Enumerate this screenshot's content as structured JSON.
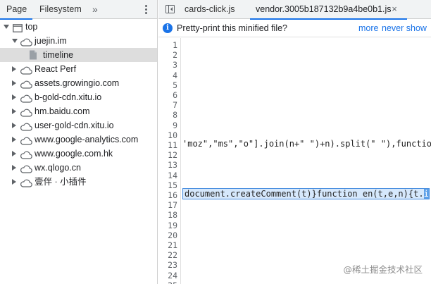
{
  "navigator": {
    "tabs": [
      "Page",
      "Filesystem"
    ],
    "more_glyph": "»",
    "menu_icon": "kebab-menu-icon",
    "tree": [
      {
        "label": "top",
        "icon": "frame-icon",
        "arrow": "down",
        "level": 0
      },
      {
        "label": "juejin.im",
        "icon": "cloud-icon",
        "arrow": "down",
        "level": 1
      },
      {
        "label": "timeline",
        "icon": "file-icon",
        "arrow": "",
        "level": 2,
        "selected": true
      },
      {
        "label": "React Perf",
        "icon": "cloud-icon",
        "arrow": "right",
        "level": 1
      },
      {
        "label": "assets.growingio.com",
        "icon": "cloud-icon",
        "arrow": "right",
        "level": 1
      },
      {
        "label": "b-gold-cdn.xitu.io",
        "icon": "cloud-icon",
        "arrow": "right",
        "level": 1
      },
      {
        "label": "hm.baidu.com",
        "icon": "cloud-icon",
        "arrow": "right",
        "level": 1
      },
      {
        "label": "user-gold-cdn.xitu.io",
        "icon": "cloud-icon",
        "arrow": "right",
        "level": 1
      },
      {
        "label": "www.google-analytics.com",
        "icon": "cloud-icon",
        "arrow": "right",
        "level": 1
      },
      {
        "label": "www.google.com.hk",
        "icon": "cloud-icon",
        "arrow": "right",
        "level": 1
      },
      {
        "label": "wx.qlogo.cn",
        "icon": "cloud-icon",
        "arrow": "right",
        "level": 1
      },
      {
        "label": "壹伴 · 小插件",
        "icon": "cloud-icon",
        "arrow": "right",
        "level": 1
      }
    ]
  },
  "editor": {
    "tabs": [
      "cards-click.js",
      "vendor.3005b187132b9a4be0b1.js"
    ],
    "active_tab": 1,
    "close_glyph": "×",
    "infobar": {
      "text": "Pretty-print this minified file?",
      "more": "more",
      "never_show": "never show"
    },
    "line_numbers": [
      "1",
      "2",
      "3",
      "4",
      "5",
      "6",
      "7",
      "8",
      "9",
      "10",
      "11",
      "12",
      "13",
      "14",
      "15",
      "16",
      "17",
      "18",
      "19",
      "20",
      "21",
      "22",
      "23",
      "24",
      "25"
    ],
    "line_11": "'moz\",\"ms\",\"o\"].join(n+\" \")+n).split(\" \"),function",
    "line_16_main": "document.createComment(t)}function en(t,e,n){t.",
    "line_16_selected": "i"
  },
  "watermark": "@稀土掘金技术社区",
  "colors": {
    "accent": "#1a73e8",
    "selected_row": "#dddddd",
    "highlight": "#d6e8fc"
  }
}
